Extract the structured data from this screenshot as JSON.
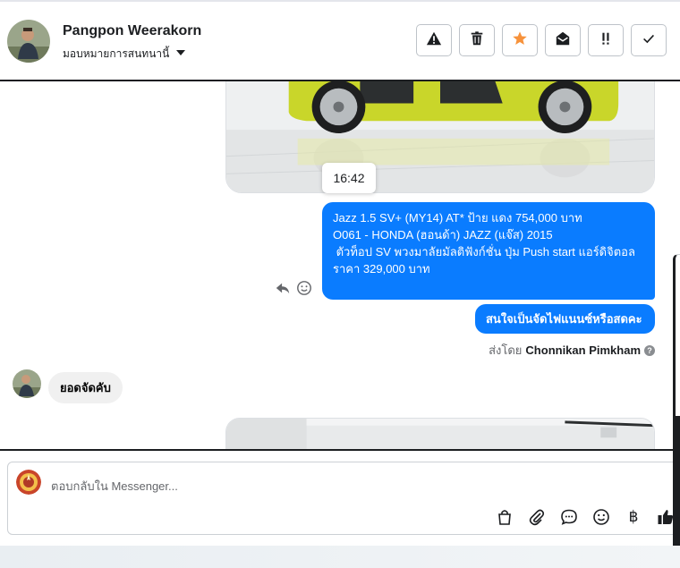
{
  "header": {
    "name": "Pangpon Weerakorn",
    "assign_label": "มอบหมายการสนทนานี้",
    "tools": [
      {
        "name": "report-icon",
        "label": "Report"
      },
      {
        "name": "trash-icon",
        "label": "Delete"
      },
      {
        "name": "star-icon",
        "label": "Star",
        "color": "#f7923b"
      },
      {
        "name": "mark-unread-icon",
        "label": "Mark unread"
      },
      {
        "name": "priority-icon",
        "label": "Priority"
      },
      {
        "name": "check-icon",
        "label": "Done"
      }
    ]
  },
  "conversation": {
    "timestamp": "16:42",
    "outgoing_lines": [
      "Jazz 1.5 SV+ (MY14) AT* ป้าย แดง 754,000 บาท",
      "O061 - HONDA (ฮอนด้า) JAZZ (แจ๊ส) 2015",
      "",
      " ตัวท็อป SV พวงมาลัยมัลติฟังก์ชั่น ปุ่ม Push start แอร์ดิจิตอล",
      "ราคา 329,000 บาท"
    ],
    "outgoing_short": "สนใจเป็นจัดไฟแนนซ์หรือสดคะ",
    "sent_by_prefix": "ส่งโดย",
    "sent_by_name": "Chonnikan Pimkham",
    "incoming": "ยอดจัดคับ"
  },
  "composer": {
    "placeholder": "ตอบกลับใน Messenger...",
    "currency_symbol": "฿"
  },
  "colors": {
    "outgoing_bubble": "#0a7cff",
    "incoming_bubble": "#f0f0f0",
    "car_body": "#c9d62a"
  }
}
